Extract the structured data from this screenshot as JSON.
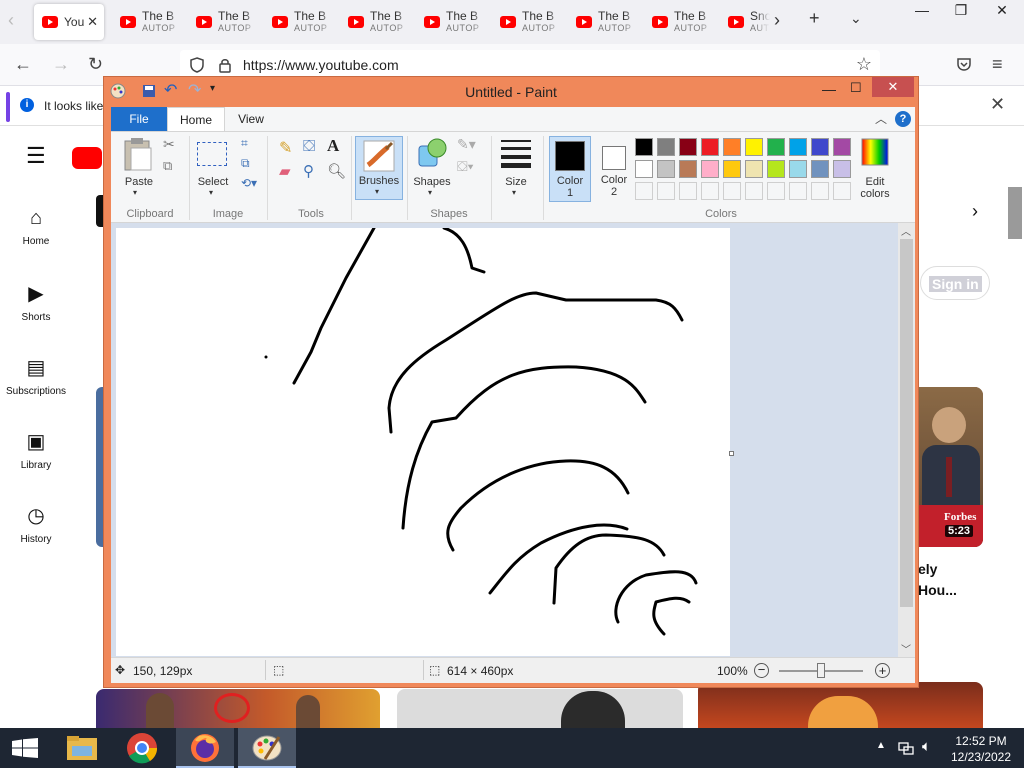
{
  "browser": {
    "tabs": [
      {
        "title": "You",
        "subtitle": "",
        "active": true
      },
      {
        "title": "The B",
        "subtitle": "AUTOP"
      },
      {
        "title": "The B",
        "subtitle": "AUTOP"
      },
      {
        "title": "The B",
        "subtitle": "AUTOP"
      },
      {
        "title": "The B",
        "subtitle": "AUTOP"
      },
      {
        "title": "The B",
        "subtitle": "AUTOP"
      },
      {
        "title": "The B",
        "subtitle": "AUTOP"
      },
      {
        "title": "The B",
        "subtitle": "AUTOP"
      },
      {
        "title": "The B",
        "subtitle": "AUTOP"
      },
      {
        "title": "Sno",
        "subtitle": "AUT"
      }
    ],
    "url": "https://www.youtube.com",
    "info_bar_text": "It looks like"
  },
  "youtube": {
    "sidebar": [
      {
        "label": "Home",
        "icon": "home-icon"
      },
      {
        "label": "Shorts",
        "icon": "shorts-icon"
      },
      {
        "label": "Subscriptions",
        "icon": "subscriptions-icon"
      },
      {
        "label": "Library",
        "icon": "library-icon"
      },
      {
        "label": "History",
        "icon": "history-icon"
      }
    ],
    "sign_in": "Sign in",
    "video": {
      "duration": "5:23",
      "badge": "Forbes",
      "title_line1": "ely",
      "title_line2": "Hou..."
    }
  },
  "paint": {
    "title": "Untitled - Paint",
    "tabs": {
      "file": "File",
      "home": "Home",
      "view": "View"
    },
    "groups": {
      "clipboard": "Clipboard",
      "image": "Image",
      "tools": "Tools",
      "shapes": "Shapes",
      "colors": "Colors"
    },
    "buttons": {
      "paste": "Paste",
      "select": "Select",
      "brushes": "Brushes",
      "shapes": "Shapes",
      "size": "Size",
      "color1_line1": "Color",
      "color1_line2": "1",
      "color2_line1": "Color",
      "color2_line2": "2",
      "edit_colors_line1": "Edit",
      "edit_colors_line2": "colors"
    },
    "palette_row1": [
      "#000000",
      "#7f7f7f",
      "#880015",
      "#ed1c24",
      "#ff7f27",
      "#fff200",
      "#22b14c",
      "#00a2e8",
      "#3f48cc",
      "#a349a4"
    ],
    "palette_row2": [
      "#ffffff",
      "#c3c3c3",
      "#b97a57",
      "#ffaec9",
      "#ffc90e",
      "#efe4b0",
      "#b5e61d",
      "#99d9ea",
      "#7092be",
      "#c8bfe7"
    ],
    "color1": "#000000",
    "color2": "#ffffff",
    "status": {
      "cursor_pos": "150, 129px",
      "canvas_size": "614 × 460px",
      "zoom": "100%",
      "zoom_fraction": 0.5
    }
  },
  "taskbar": {
    "time": "12:52 PM",
    "date": "12/23/2022"
  }
}
